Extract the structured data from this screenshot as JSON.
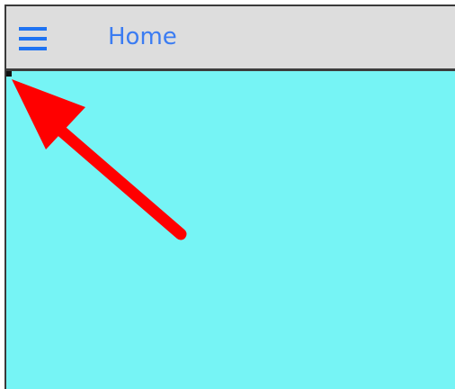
{
  "app_bar": {
    "title": "Home",
    "menu_icon": "hamburger-menu-icon"
  },
  "colors": {
    "app_bar_background": "#dddddd",
    "title_text": "#3b7cf2",
    "menu_icon": "#1f73f2",
    "content_background": "#76f4f5",
    "annotation_arrow": "#ff0000"
  },
  "annotation": {
    "icon": "red-arrow-icon"
  }
}
